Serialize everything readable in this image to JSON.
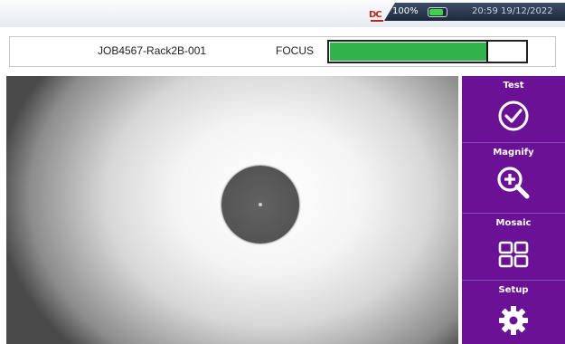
{
  "status": {
    "dc_icon": "DC",
    "battery_percent": "100%",
    "battery_level": 0.85,
    "datetime": "20:59 19/12/2022"
  },
  "info": {
    "job": "JOB4567-Rack2B-001",
    "focus_label": "FOCUS",
    "focus_level": 0.8,
    "focus_peak": 0.8
  },
  "side_buttons": [
    {
      "label": "Test",
      "icon": "check-circle-icon"
    },
    {
      "label": "Magnify",
      "icon": "magnify-plus-icon"
    },
    {
      "label": "Mosaic",
      "icon": "mosaic-grid-icon"
    },
    {
      "label": "Setup",
      "icon": "gear-icon"
    }
  ],
  "colors": {
    "panel_purple": "#6b1196",
    "focus_green": "#2fb34a",
    "status_dark": "#1d2a3d"
  }
}
